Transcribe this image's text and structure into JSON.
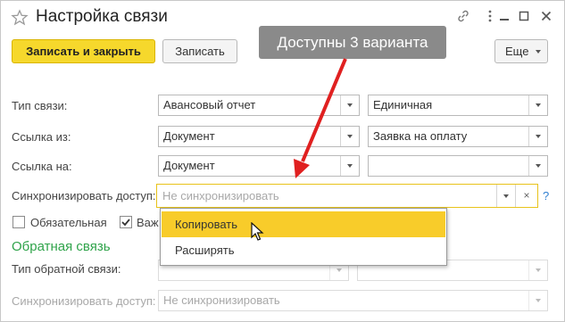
{
  "window": {
    "title": "Настройка связи",
    "icons": [
      "star-icon",
      "link-icon",
      "more-icon",
      "minimize-icon",
      "maximize-icon",
      "close-icon"
    ]
  },
  "toolbar": {
    "save_close_label": "Записать и закрыть",
    "save_label": "Записать",
    "more_label": "Еще"
  },
  "callout": {
    "text": "Доступны 3 варианта"
  },
  "form": {
    "link_type": {
      "label": "Тип связи:",
      "value1": "Авансовый отчет",
      "value2": "Единичная"
    },
    "link_from": {
      "label": "Ссылка из:",
      "value1": "Документ",
      "value2": "Заявка на оплату"
    },
    "link_to": {
      "label": "Ссылка на:",
      "value1": "Документ",
      "value2": ""
    },
    "sync_access": {
      "label": "Синхронизировать доступ:",
      "placeholder": "Не синхронизировать",
      "help": "?"
    },
    "mandatory": {
      "label": "Обязательная",
      "checked": false
    },
    "important": {
      "label": "Важ",
      "checked": true
    }
  },
  "reverse": {
    "section_title": "Обратная связь",
    "type": {
      "label": "Тип обратной связи:",
      "value1": "",
      "value2": ""
    },
    "sync_access": {
      "label": "Синхронизировать доступ:",
      "placeholder": "Не синхронизировать"
    }
  },
  "dropdown": {
    "options": [
      "Копировать",
      "Расширять"
    ],
    "selected_index": 0
  },
  "colors": {
    "accent_yellow": "#f6d82c",
    "section_green": "#2fa34a",
    "callout_arrow": "#e02020",
    "callout_bg": "#8a8a8a"
  }
}
